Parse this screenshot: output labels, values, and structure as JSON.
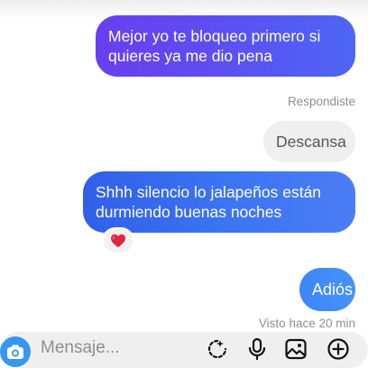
{
  "messages": [
    {
      "text": "Mejor yo te bloqueo primero si\nquieres ya me dio pena"
    },
    {
      "text": "Shhh silencio lo jalapeños están\ndurmiendo buenas noches"
    },
    {
      "text": "Adiós"
    }
  ],
  "reply": {
    "label": "Respondiste",
    "text": "Descansa"
  },
  "reaction": {
    "icon": "heart-icon"
  },
  "status": {
    "seen": "Visto hace 20 min"
  },
  "composer": {
    "placeholder": "Mensaje...",
    "icons": [
      "camera-icon",
      "sticker-icon",
      "microphone-icon",
      "gallery-icon",
      "add-icon"
    ]
  },
  "colors": {
    "bubble_purple": "#6a3ef0",
    "bubble_blue": "#3b73f2",
    "bubble_light_blue": "#4792f9",
    "camera_blue": "#3797f0",
    "heart_red": "#e0273e"
  }
}
